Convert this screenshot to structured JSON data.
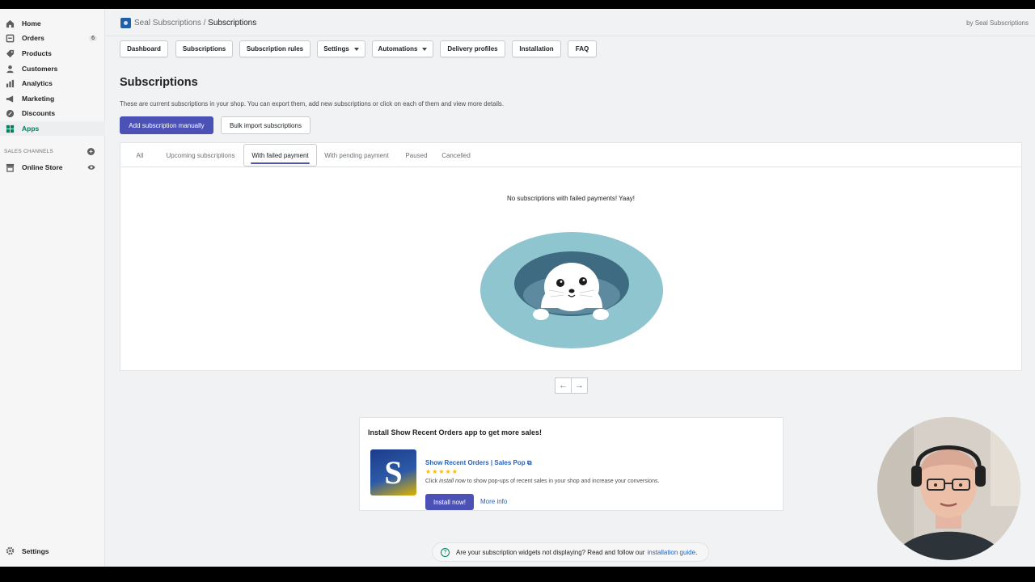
{
  "sidebar": {
    "items": [
      {
        "label": "Home",
        "icon": "home-icon"
      },
      {
        "label": "Orders",
        "icon": "orders-icon",
        "badge": "6"
      },
      {
        "label": "Products",
        "icon": "products-icon"
      },
      {
        "label": "Customers",
        "icon": "customers-icon"
      },
      {
        "label": "Analytics",
        "icon": "analytics-icon"
      },
      {
        "label": "Marketing",
        "icon": "marketing-icon"
      },
      {
        "label": "Discounts",
        "icon": "discounts-icon"
      },
      {
        "label": "Apps",
        "icon": "apps-icon",
        "active": true
      }
    ],
    "sales_channels_title": "SALES CHANNELS",
    "online_store": "Online Store",
    "settings": "Settings"
  },
  "appbar": {
    "app_name": "Seal Subscriptions",
    "separator": " / ",
    "current": "Subscriptions",
    "by": "by Seal Subscriptions"
  },
  "top_tabs": [
    "Dashboard",
    "Subscriptions",
    "Subscription rules",
    "Settings",
    "Automations",
    "Delivery profiles",
    "Installation",
    "FAQ"
  ],
  "page": {
    "title": "Subscriptions",
    "description": "These are current subscriptions in your shop. You can export them, add new subscriptions or click on each of them and view more details.",
    "add_button": "Add subscription manually",
    "import_button": "Bulk import subscriptions"
  },
  "filter_tabs": {
    "items": [
      "All",
      "Upcoming subscriptions",
      "With failed payment",
      "With pending payment",
      "Paused",
      "Cancelled"
    ],
    "selected": "With failed payment"
  },
  "empty_state": {
    "message": "No subscriptions with failed payments! Yaay!"
  },
  "pagination": {
    "prev": "←",
    "next": "→"
  },
  "promo": {
    "title": "Install Show Recent Orders app to get more sales!",
    "logo_letter": "S",
    "app_name": "Show Recent Orders | Sales Pop",
    "stars": "★★★★★",
    "rating": 5,
    "desc_prefix": "Click ",
    "desc_em": "install now",
    "desc_suffix": " to show pop-ups of recent sales in your shop and increase your conversions.",
    "install_button": "Install now!",
    "more_info": "More info"
  },
  "help": {
    "text": "Are your subscription widgets not displaying? Read and follow our",
    "link": "installation guide",
    "suffix": "."
  },
  "colors": {
    "primary": "#4c52b5",
    "active_nav": "#008060",
    "link": "#2463bc",
    "seal_pool": "#8ec5cf"
  }
}
